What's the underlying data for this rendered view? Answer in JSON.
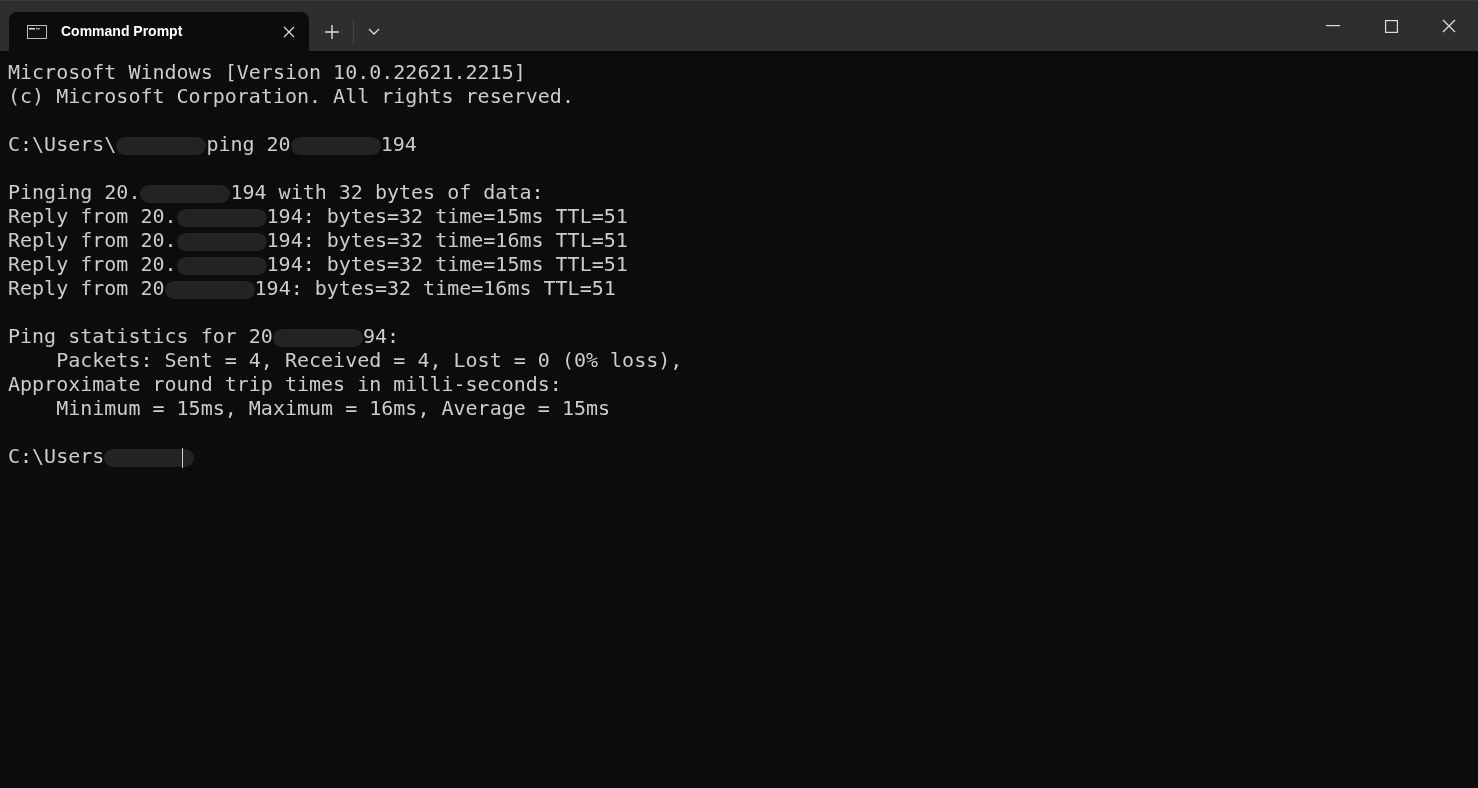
{
  "tab": {
    "title": "Command Prompt",
    "selected": true
  },
  "blocks": [
    [
      [
        {
          "kind": "text",
          "text": "Microsoft Windows [Version 10.0.22621.2215]"
        }
      ],
      [
        {
          "kind": "text",
          "text": "(c) Microsoft Corporation. All rights reserved."
        }
      ]
    ],
    [
      [
        {
          "kind": "text",
          "text": "C:\\Users\\"
        },
        {
          "kind": "redaction"
        },
        {
          "kind": "text",
          "text": "ping 20"
        },
        {
          "kind": "redaction"
        },
        {
          "kind": "text",
          "text": "194"
        }
      ]
    ],
    [
      [
        {
          "kind": "text",
          "text": "Pinging 20."
        },
        {
          "kind": "redaction"
        },
        {
          "kind": "text",
          "text": "194 with 32 bytes of data:"
        }
      ],
      [
        {
          "kind": "text",
          "text": "Reply from 20."
        },
        {
          "kind": "redaction"
        },
        {
          "kind": "text",
          "text": "194: bytes=32 time=15ms TTL=51"
        }
      ],
      [
        {
          "kind": "text",
          "text": "Reply from 20."
        },
        {
          "kind": "redaction"
        },
        {
          "kind": "text",
          "text": "194: bytes=32 time=16ms TTL=51"
        }
      ],
      [
        {
          "kind": "text",
          "text": "Reply from 20."
        },
        {
          "kind": "redaction"
        },
        {
          "kind": "text",
          "text": "194: bytes=32 time=15ms TTL=51"
        }
      ],
      [
        {
          "kind": "text",
          "text": "Reply from 20"
        },
        {
          "kind": "redaction"
        },
        {
          "kind": "text",
          "text": "194: bytes=32 time=16ms TTL=51"
        }
      ]
    ],
    [
      [
        {
          "kind": "text",
          "text": "Ping statistics for 20"
        },
        {
          "kind": "redaction"
        },
        {
          "kind": "text",
          "text": "94:"
        }
      ],
      [
        {
          "kind": "text",
          "text": "    Packets: Sent = 4, Received = 4, Lost = 0 (0% loss),"
        }
      ],
      [
        {
          "kind": "text",
          "text": "Approximate round trip times in milli-seconds:"
        }
      ],
      [
        {
          "kind": "text",
          "text": "    Minimum = 15ms, Maximum = 16ms, Average = 15ms"
        }
      ]
    ],
    [
      [
        {
          "kind": "text",
          "text": "C:\\Users"
        },
        {
          "kind": "redaction"
        },
        {
          "kind": "cursor"
        }
      ]
    ]
  ]
}
